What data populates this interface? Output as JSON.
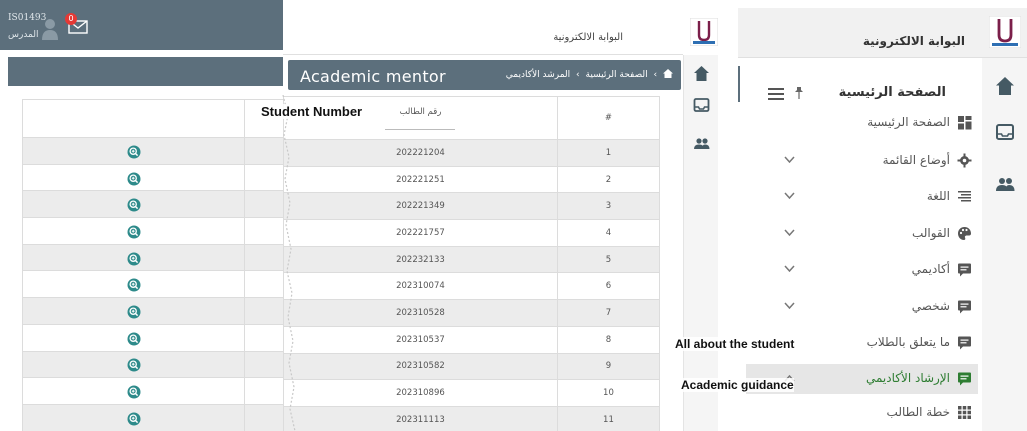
{
  "left_panel": {
    "user_id": "IS01493",
    "user_role": "المدرس",
    "notification_count": "0",
    "row_count": 11
  },
  "middle_panel": {
    "portal_title": "البوابة الالكترونية",
    "page_title": "Academic mentor",
    "breadcrumb": {
      "home": "الصفحة الرئيسية",
      "current": "المرشد الأكاديمي"
    },
    "table": {
      "headers": {
        "number": "#",
        "student_number": "رقم الطالب"
      },
      "rows": [
        {
          "n": "1",
          "sn": "202221204"
        },
        {
          "n": "2",
          "sn": "202221251"
        },
        {
          "n": "3",
          "sn": "202221349"
        },
        {
          "n": "4",
          "sn": "202221757"
        },
        {
          "n": "5",
          "sn": "202232133"
        },
        {
          "n": "6",
          "sn": "202310074"
        },
        {
          "n": "7",
          "sn": "202310528"
        },
        {
          "n": "8",
          "sn": "202310537"
        },
        {
          "n": "9",
          "sn": "202310582"
        },
        {
          "n": "10",
          "sn": "202310896"
        },
        {
          "n": "11",
          "sn": "202311113"
        }
      ]
    }
  },
  "right_panel": {
    "portal_title": "البوابة الالكترونية",
    "menu_title": "الصفحة الرئيسية",
    "menu": [
      {
        "label": "الصفحة الرئيسية",
        "icon": "dashboard-icon",
        "chevron": false
      },
      {
        "label": "أوضاع القائمة",
        "icon": "gear-icon",
        "chevron": true
      },
      {
        "label": "اللغة",
        "icon": "align-icon",
        "chevron": true
      },
      {
        "label": "القوالب",
        "icon": "palette-icon",
        "chevron": true
      },
      {
        "label": "أكاديمي",
        "icon": "message-icon",
        "chevron": true
      },
      {
        "label": "شخصي",
        "icon": "message-icon",
        "chevron": true
      },
      {
        "label": "ما يتعلق بالطلاب",
        "icon": "message-icon",
        "chevron": false
      },
      {
        "label": "الإرشاد الأكاديمي",
        "icon": "message-icon",
        "chevron": true,
        "active": true
      },
      {
        "label": "خطة الطالب",
        "icon": "grid-icon",
        "chevron": false
      }
    ]
  },
  "annotations": {
    "student_number": "Student Number",
    "all_about_student": "All about the student",
    "academic_guidance": "Academic guidance"
  },
  "colors": {
    "header_bar": "#5c6f7c",
    "zoom_icon": "#2d8a8a",
    "active_text": "#2e7d32",
    "badge": "#e53935"
  }
}
